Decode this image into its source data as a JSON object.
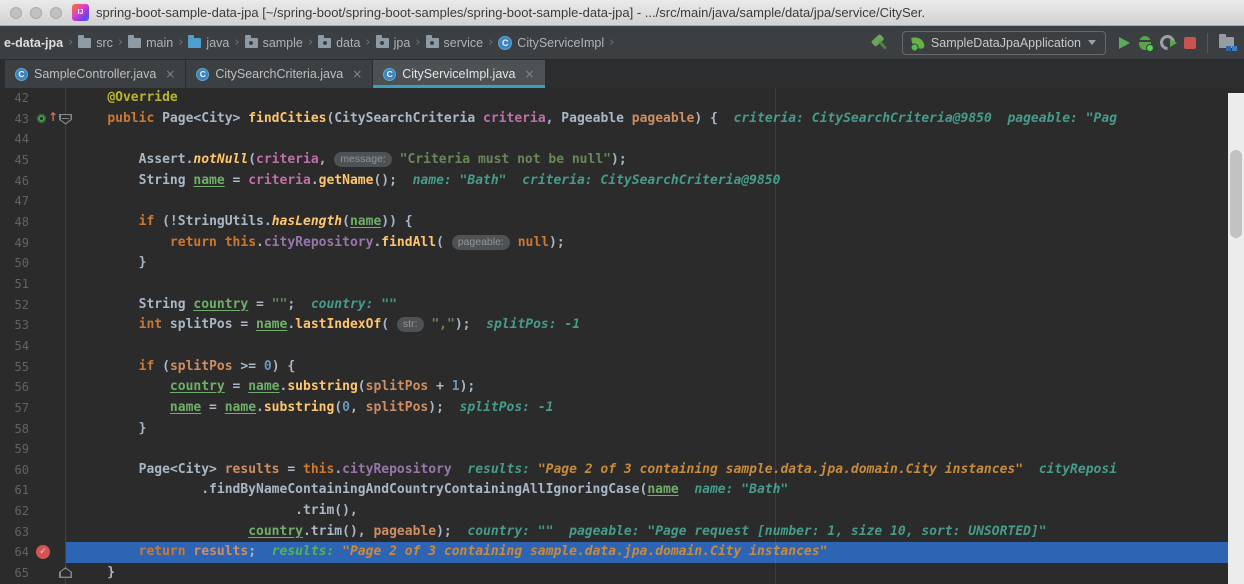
{
  "window": {
    "title": "spring-boot-sample-data-jpa [~/spring-boot/spring-boot-samples/spring-boot-sample-data-jpa] - .../src/main/java/sample/data/jpa/service/CitySer.",
    "app_icon": "intellij-idea-logo",
    "traffic_lights": [
      "close",
      "minimize",
      "zoom"
    ]
  },
  "breadcrumbs": {
    "items": [
      {
        "label": "e-data-jpa",
        "icon": "project",
        "bold": true
      },
      {
        "label": "src",
        "icon": "folder"
      },
      {
        "label": "main",
        "icon": "folder"
      },
      {
        "label": "java",
        "icon": "folder-source"
      },
      {
        "label": "sample",
        "icon": "package"
      },
      {
        "label": "data",
        "icon": "package"
      },
      {
        "label": "jpa",
        "icon": "package"
      },
      {
        "label": "service",
        "icon": "package"
      },
      {
        "label": "CityServiceImpl",
        "icon": "class"
      }
    ]
  },
  "toolbar": {
    "run_config": {
      "label": "SampleDataJpaApplication",
      "icon": "spring-boot-leaf-icon"
    },
    "buttons": [
      {
        "kind": "hammer",
        "name": "build-hammer-icon"
      },
      {
        "kind": "combo",
        "name": "run-configuration-select"
      },
      {
        "kind": "play",
        "name": "run-button"
      },
      {
        "kind": "bug",
        "name": "debug-button"
      },
      {
        "kind": "coverage",
        "name": "run-with-coverage-button"
      },
      {
        "kind": "stop",
        "name": "stop-button"
      },
      {
        "kind": "separator",
        "name": "toolbar-separator"
      },
      {
        "kind": "toolwin",
        "name": "tool-window-icon"
      }
    ]
  },
  "tabs": [
    {
      "label": "SampleController.java",
      "icon": "class",
      "close": "×",
      "active": false
    },
    {
      "label": "CitySearchCriteria.java",
      "icon": "class",
      "close": "×",
      "active": false
    },
    {
      "label": "CityServiceImpl.java",
      "icon": "class",
      "close": "×",
      "active": true
    }
  ],
  "editor": {
    "colors": {
      "background": "#2B2B2B",
      "execution_line": "#2D65B4",
      "tab_accent": "#3C9FBC",
      "breakpoint": "#D25454",
      "inline_hint": "#459C8B"
    },
    "lines": [
      {
        "num": "42",
        "segs": [
          [
            "d",
            "    "
          ],
          [
            "ann",
            "@Override"
          ]
        ]
      },
      {
        "num": "43",
        "gutter": "override",
        "fold": "top",
        "segs": [
          [
            "d",
            "    "
          ],
          [
            "kw",
            "public"
          ],
          [
            "d",
            " Page<City> "
          ],
          [
            "md",
            "findCities"
          ],
          [
            "d",
            "(CitySearchCriteria "
          ],
          [
            "crit",
            "criteria"
          ],
          [
            "d",
            ", Pageable "
          ],
          [
            "vo",
            "pageable"
          ],
          [
            "d",
            ") {"
          ],
          [
            "h",
            "  criteria: CitySearchCriteria@9850  pageable: \"Pag"
          ]
        ]
      },
      {
        "num": "44",
        "segs": []
      },
      {
        "num": "45",
        "segs": [
          [
            "d",
            "        Assert."
          ],
          [
            "sc",
            "notNull"
          ],
          [
            "d",
            "("
          ],
          [
            "crit",
            "criteria"
          ],
          [
            "d",
            ", "
          ],
          [
            "chip",
            "message:"
          ],
          [
            "d",
            " "
          ],
          [
            "str",
            "\"Criteria must not be null\""
          ],
          [
            "d",
            ");"
          ]
        ]
      },
      {
        "num": "46",
        "segs": [
          [
            "d",
            "        String "
          ],
          [
            "uv",
            "name"
          ],
          [
            "d",
            " = "
          ],
          [
            "crit",
            "criteria"
          ],
          [
            "d",
            "."
          ],
          [
            "mc",
            "getName"
          ],
          [
            "d",
            "();"
          ],
          [
            "h",
            "  name: \"Bath\"  criteria: CitySearchCriteria@9850"
          ]
        ]
      },
      {
        "num": "47",
        "segs": []
      },
      {
        "num": "48",
        "segs": [
          [
            "d",
            "        "
          ],
          [
            "kw",
            "if"
          ],
          [
            "d",
            " (!StringUtils."
          ],
          [
            "sc",
            "hasLength"
          ],
          [
            "d",
            "("
          ],
          [
            "uv",
            "name"
          ],
          [
            "d",
            ")) {"
          ]
        ]
      },
      {
        "num": "49",
        "segs": [
          [
            "d",
            "            "
          ],
          [
            "kw",
            "return"
          ],
          [
            "d",
            " "
          ],
          [
            "kw",
            "this"
          ],
          [
            "d",
            "."
          ],
          [
            "f",
            "cityRepository"
          ],
          [
            "d",
            "."
          ],
          [
            "mc",
            "findAll"
          ],
          [
            "d",
            "( "
          ],
          [
            "chip",
            "pageable:"
          ],
          [
            "d",
            " "
          ],
          [
            "kw",
            "null"
          ],
          [
            "d",
            ");"
          ]
        ]
      },
      {
        "num": "50",
        "segs": [
          [
            "d",
            "        }"
          ]
        ]
      },
      {
        "num": "51",
        "segs": []
      },
      {
        "num": "52",
        "segs": [
          [
            "d",
            "        String "
          ],
          [
            "uv",
            "country"
          ],
          [
            "d",
            " = "
          ],
          [
            "str",
            "\"\""
          ],
          [
            "d",
            ";"
          ],
          [
            "h",
            "  country: \"\""
          ]
        ]
      },
      {
        "num": "53",
        "segs": [
          [
            "d",
            "        "
          ],
          [
            "kw",
            "int"
          ],
          [
            "d",
            " splitPos = "
          ],
          [
            "uv",
            "name"
          ],
          [
            "d",
            "."
          ],
          [
            "mc",
            "lastIndexOf"
          ],
          [
            "d",
            "( "
          ],
          [
            "chip",
            "str:"
          ],
          [
            "d",
            " "
          ],
          [
            "str",
            "\",\""
          ],
          [
            "d",
            ");"
          ],
          [
            "h",
            "  splitPos: -1"
          ]
        ]
      },
      {
        "num": "54",
        "segs": []
      },
      {
        "num": "55",
        "segs": [
          [
            "d",
            "        "
          ],
          [
            "kw",
            "if"
          ],
          [
            "d",
            " ("
          ],
          [
            "vo",
            "splitPos"
          ],
          [
            "d",
            " >= "
          ],
          [
            "n",
            "0"
          ],
          [
            "d",
            ") {"
          ]
        ]
      },
      {
        "num": "56",
        "segs": [
          [
            "d",
            "            "
          ],
          [
            "uv",
            "country"
          ],
          [
            "d",
            " = "
          ],
          [
            "uv",
            "name"
          ],
          [
            "d",
            "."
          ],
          [
            "mc",
            "substring"
          ],
          [
            "d",
            "("
          ],
          [
            "vo",
            "splitPos"
          ],
          [
            "d",
            " + "
          ],
          [
            "n",
            "1"
          ],
          [
            "d",
            ");"
          ]
        ]
      },
      {
        "num": "57",
        "segs": [
          [
            "d",
            "            "
          ],
          [
            "uv",
            "name"
          ],
          [
            "d",
            " = "
          ],
          [
            "uv",
            "name"
          ],
          [
            "d",
            "."
          ],
          [
            "mc",
            "substring"
          ],
          [
            "d",
            "("
          ],
          [
            "n",
            "0"
          ],
          [
            "d",
            ", "
          ],
          [
            "vo",
            "splitPos"
          ],
          [
            "d",
            ");"
          ],
          [
            "h",
            "  splitPos: -1"
          ]
        ]
      },
      {
        "num": "58",
        "segs": [
          [
            "d",
            "        }"
          ]
        ]
      },
      {
        "num": "59",
        "segs": []
      },
      {
        "num": "60",
        "segs": [
          [
            "d",
            "        Page<City> "
          ],
          [
            "vo",
            "results"
          ],
          [
            "d",
            " = "
          ],
          [
            "kw",
            "this"
          ],
          [
            "d",
            "."
          ],
          [
            "f",
            "cityRepository"
          ],
          [
            "h",
            "  results: "
          ],
          [
            "ho",
            "\"Page 2 of 3 containing sample.data.jpa.domain.City instances\""
          ],
          [
            "h",
            "  cityReposi"
          ]
        ]
      },
      {
        "num": "61",
        "segs": [
          [
            "d",
            "                .findByNameContainingAndCountryContainingAllIgnoringCase("
          ],
          [
            "uv",
            "name"
          ],
          [
            "h",
            "  name: \"Bath\""
          ]
        ]
      },
      {
        "num": "62",
        "segs": [
          [
            "d",
            "                            .trim(),"
          ]
        ]
      },
      {
        "num": "63",
        "segs": [
          [
            "d",
            "                      "
          ],
          [
            "uv",
            "country"
          ],
          [
            "d",
            ".trim(), "
          ],
          [
            "vo",
            "pageable"
          ],
          [
            "d",
            ");"
          ],
          [
            "h",
            "  country: \"\"  pageable: \"Page request [number: 1, size 10, sort: UNSORTED]\""
          ]
        ]
      },
      {
        "num": "64",
        "gutter": "breakpoint",
        "current": true,
        "segs": [
          [
            "d",
            "        "
          ],
          [
            "kw",
            "return"
          ],
          [
            "d",
            " "
          ],
          [
            "vo",
            "results"
          ],
          [
            "d",
            ";"
          ],
          [
            "hg",
            "  results: "
          ],
          [
            "ho",
            "\"Page 2 of 3 containing sample.data.jpa.domain.City instances\""
          ]
        ]
      },
      {
        "num": "65",
        "fold": "bottom",
        "segs": [
          [
            "d",
            "    }"
          ]
        ]
      }
    ]
  },
  "page_scrollbar": {
    "visible": true
  }
}
